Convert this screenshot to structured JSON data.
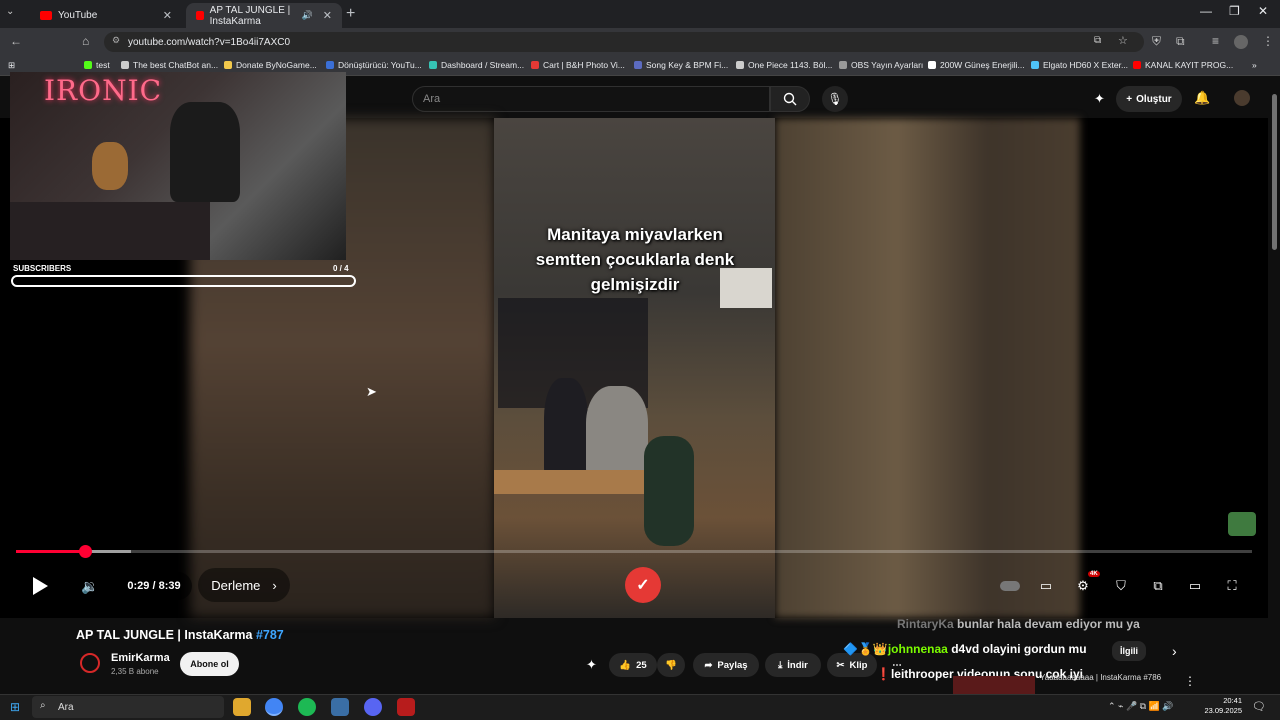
{
  "browser": {
    "tabs": [
      {
        "label": "YouTube",
        "active": false
      },
      {
        "label": "AP TAL JUNGLE | InstaKarma",
        "active": true
      }
    ],
    "url": "youtube.com/watch?v=1Bo4ii7AXC0",
    "bookmarks": [
      "test",
      "The best ChatBot an...",
      "Donate ByNoGame...",
      "Dönüştürücü: YouTu...",
      "Dashboard / Stream...",
      "Cart | B&H Photo Vi...",
      "Song Key & BPM Fi...",
      "One Piece 1143. Böl...",
      "OBS Yayın Ayarları",
      "200W Güneş Enerjili...",
      "Elgato HD60 X Exter...",
      "KANAL KAYIT PROG..."
    ]
  },
  "youtube": {
    "search_placeholder": "Ara",
    "create_label": "Oluştur"
  },
  "overlay": {
    "cam_title": "IRONIC",
    "subs_label": "SUBSCRIBERS",
    "subs_count": "0  / 4",
    "subs_progress": 0
  },
  "video": {
    "caption": "Manitaya miyavlarken\nsemtten çocuklarla denk\ngelmişizdir",
    "time": "0:29 / 8:39",
    "chapter": "Derleme",
    "progress_fraction": 0.056,
    "buffered_fraction": 0.093,
    "quality_badge": "4K",
    "title": "AP TAL JUNGLE | InstaKarma",
    "title_tag": "#787",
    "channel": "EmirKarma",
    "channel_subs": "2,35 B abone",
    "subscribe_label": "Abone ol",
    "likes": "25",
    "share_label": "Paylaş",
    "download_label": "İndir",
    "clip_label": "Klip"
  },
  "chat": {
    "line1_user": "RintaryKa",
    "line1_text": "bunlar hala devam ediyor mu ya",
    "line2_user": "johnnenaa",
    "line2_text": "d4vd olayini gordun mu",
    "line3_user": "leithrooper",
    "line3_text": "videonun sonu cok iyi"
  },
  "related": {
    "chip_related": "İlgili",
    "next_title": "Yaaaaaaaaaaa | InstaKarma #786"
  },
  "taskbar": {
    "search": "Ara",
    "time": "20:41",
    "date": "23.09.2025"
  },
  "colors": {
    "accent": "#ff0033",
    "link": "#3ea6ff",
    "background": "#0f0f0f"
  }
}
